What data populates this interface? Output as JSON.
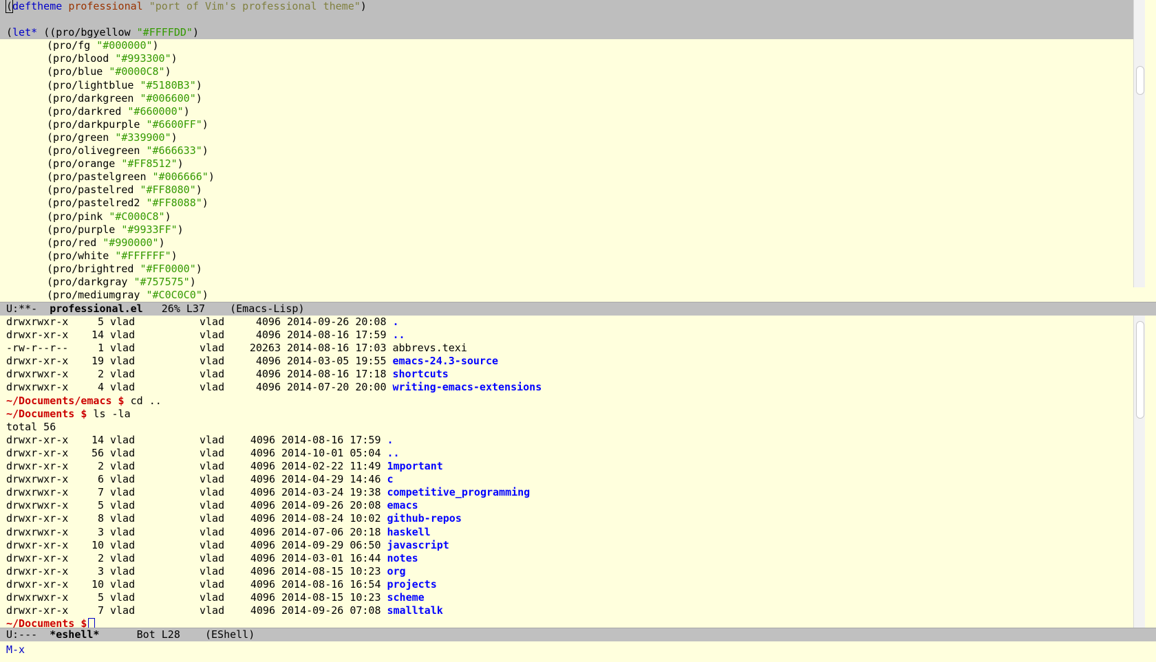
{
  "editor": {
    "line1": {
      "open": "(",
      "kw": "deftheme",
      "name": "professional",
      "doc": "\"port of Vim's professional theme\"",
      "close": ")"
    },
    "let_line": {
      "kw": "let*",
      "first": "((pro/bgyellow ",
      "value": "\"#FFFFDD\"",
      "close": ")"
    },
    "bindings": [
      {
        "name": "(pro/fg ",
        "value": "\"#000000\""
      },
      {
        "name": "(pro/blood ",
        "value": "\"#993300\""
      },
      {
        "name": "(pro/blue ",
        "value": "\"#0000C8\""
      },
      {
        "name": "(pro/lightblue ",
        "value": "\"#5180B3\""
      },
      {
        "name": "(pro/darkgreen ",
        "value": "\"#006600\""
      },
      {
        "name": "(pro/darkred ",
        "value": "\"#660000\""
      },
      {
        "name": "(pro/darkpurple ",
        "value": "\"#6600FF\""
      },
      {
        "name": "(pro/green ",
        "value": "\"#339900\""
      },
      {
        "name": "(pro/olivegreen ",
        "value": "\"#666633\""
      },
      {
        "name": "(pro/orange ",
        "value": "\"#FF8512\""
      },
      {
        "name": "(pro/pastelgreen ",
        "value": "\"#006666\""
      },
      {
        "name": "(pro/pastelred ",
        "value": "\"#FF8080\""
      },
      {
        "name": "(pro/pastelred2 ",
        "value": "\"#FF8088\""
      },
      {
        "name": "(pro/pink ",
        "value": "\"#C000C8\""
      },
      {
        "name": "(pro/purple ",
        "value": "\"#9933FF\""
      },
      {
        "name": "(pro/red ",
        "value": "\"#990000\""
      },
      {
        "name": "(pro/white ",
        "value": "\"#FFFFFF\""
      },
      {
        "name": "(pro/brightred ",
        "value": "\"#FF0000\""
      },
      {
        "name": "(pro/darkgray ",
        "value": "\"#757575\""
      },
      {
        "name": "(pro/mediumgray ",
        "value": "\"#C0C0C0\""
      }
    ]
  },
  "top_modeline": {
    "status": "U:**-",
    "buffer": "professional.el",
    "position": "26% L37",
    "mode": "(Emacs-Lisp)"
  },
  "shell": {
    "listing1": [
      {
        "perm": "drwxrwxr-x",
        "links": "5",
        "owner": "vlad",
        "group": "vlad",
        "size": "4096",
        "date": "2014-09-26 20:08",
        "name": ".",
        "dir": true
      },
      {
        "perm": "drwxr-xr-x",
        "links": "14",
        "owner": "vlad",
        "group": "vlad",
        "size": "4096",
        "date": "2014-08-16 17:59",
        "name": "..",
        "dir": true
      },
      {
        "perm": "-rw-r--r--",
        "links": "1",
        "owner": "vlad",
        "group": "vlad",
        "size": "20263",
        "date": "2014-08-16 17:03",
        "name": "abbrevs.texi",
        "dir": false
      },
      {
        "perm": "drwxr-xr-x",
        "links": "19",
        "owner": "vlad",
        "group": "vlad",
        "size": "4096",
        "date": "2014-03-05 19:55",
        "name": "emacs-24.3-source",
        "dir": true
      },
      {
        "perm": "drwxrwxr-x",
        "links": "2",
        "owner": "vlad",
        "group": "vlad",
        "size": "4096",
        "date": "2014-08-16 17:18",
        "name": "shortcuts",
        "dir": true
      },
      {
        "perm": "drwxrwxr-x",
        "links": "4",
        "owner": "vlad",
        "group": "vlad",
        "size": "4096",
        "date": "2014-07-20 20:00",
        "name": "writing-emacs-extensions",
        "dir": true
      }
    ],
    "cmd1": {
      "prompt": "~/Documents/emacs $",
      "command": " cd .."
    },
    "cmd2": {
      "prompt": "~/Documents $",
      "command": " ls -la"
    },
    "total": "total 56",
    "listing2": [
      {
        "perm": "drwxr-xr-x",
        "links": "14",
        "owner": "vlad",
        "group": "vlad",
        "size": "4096",
        "date": "2014-08-16 17:59",
        "name": ".",
        "dir": true
      },
      {
        "perm": "drwxr-xr-x",
        "links": "56",
        "owner": "vlad",
        "group": "vlad",
        "size": "4096",
        "date": "2014-10-01 05:04",
        "name": "..",
        "dir": true
      },
      {
        "perm": "drwxr-xr-x",
        "links": "2",
        "owner": "vlad",
        "group": "vlad",
        "size": "4096",
        "date": "2014-02-22 11:49",
        "name": "1mportant",
        "dir": true
      },
      {
        "perm": "drwxrwxr-x",
        "links": "6",
        "owner": "vlad",
        "group": "vlad",
        "size": "4096",
        "date": "2014-04-29 14:46",
        "name": "c",
        "dir": true
      },
      {
        "perm": "drwxrwxr-x",
        "links": "7",
        "owner": "vlad",
        "group": "vlad",
        "size": "4096",
        "date": "2014-03-24 19:38",
        "name": "competitive_programming",
        "dir": true
      },
      {
        "perm": "drwxrwxr-x",
        "links": "5",
        "owner": "vlad",
        "group": "vlad",
        "size": "4096",
        "date": "2014-09-26 20:08",
        "name": "emacs",
        "dir": true
      },
      {
        "perm": "drwxr-xr-x",
        "links": "8",
        "owner": "vlad",
        "group": "vlad",
        "size": "4096",
        "date": "2014-08-24 10:02",
        "name": "github-repos",
        "dir": true
      },
      {
        "perm": "drwxrwxr-x",
        "links": "3",
        "owner": "vlad",
        "group": "vlad",
        "size": "4096",
        "date": "2014-07-06 20:18",
        "name": "haskell",
        "dir": true
      },
      {
        "perm": "drwxr-xr-x",
        "links": "10",
        "owner": "vlad",
        "group": "vlad",
        "size": "4096",
        "date": "2014-09-29 06:50",
        "name": "javascript",
        "dir": true
      },
      {
        "perm": "drwxr-xr-x",
        "links": "2",
        "owner": "vlad",
        "group": "vlad",
        "size": "4096",
        "date": "2014-03-01 16:44",
        "name": "notes",
        "dir": true
      },
      {
        "perm": "drwxr-xr-x",
        "links": "3",
        "owner": "vlad",
        "group": "vlad",
        "size": "4096",
        "date": "2014-08-15 10:23",
        "name": "org",
        "dir": true
      },
      {
        "perm": "drwxr-xr-x",
        "links": "10",
        "owner": "vlad",
        "group": "vlad",
        "size": "4096",
        "date": "2014-08-16 16:54",
        "name": "projects",
        "dir": true
      },
      {
        "perm": "drwxrwxr-x",
        "links": "5",
        "owner": "vlad",
        "group": "vlad",
        "size": "4096",
        "date": "2014-08-15 10:23",
        "name": "scheme",
        "dir": true
      },
      {
        "perm": "drwxr-xr-x",
        "links": "7",
        "owner": "vlad",
        "group": "vlad",
        "size": "4096",
        "date": "2014-09-26 07:08",
        "name": "smalltalk",
        "dir": true
      }
    ],
    "final_prompt": "~/Documents $"
  },
  "bottom_modeline": {
    "status": "U:---",
    "buffer": "*eshell*",
    "position": "Bot L28",
    "mode": "(EShell)"
  },
  "echo_area": {
    "text": "M-x"
  }
}
